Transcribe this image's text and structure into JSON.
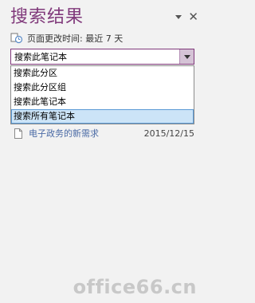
{
  "pane": {
    "title": "搜索结果"
  },
  "timebar": {
    "label": "页面更改时间: 最近 7 天"
  },
  "scope": {
    "current_value": "搜索此笔记本",
    "options": [
      "搜索此分区",
      "搜索此分区组",
      "搜索此笔记本",
      "搜索所有笔记本"
    ]
  },
  "results": [
    {
      "title": "电子政务的新需求",
      "date": "2015/12/15"
    }
  ],
  "watermark": {
    "text": "office66.cn"
  },
  "colors": {
    "accent": "#80397b",
    "selection": "#cce4f7",
    "link": "#4a6aa5"
  }
}
